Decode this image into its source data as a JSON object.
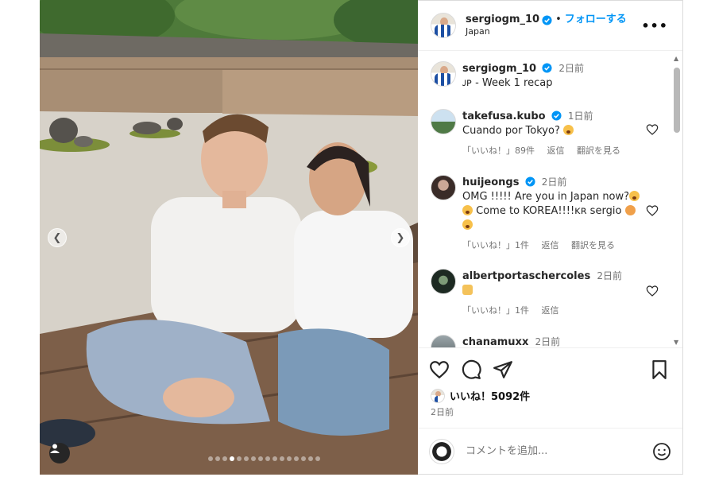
{
  "post": {
    "username": "sergiogm_10",
    "follow_label": "フォローする",
    "separator": "•",
    "location": "Japan",
    "more_label": "•••"
  },
  "caption": {
    "username": "sergiogm_10",
    "time": "2日前",
    "text": "ᴊᴘ - Week 1 recap"
  },
  "comments": [
    {
      "username": "takefusa.kubo",
      "time": "1日前",
      "text": "Cuando por Tokyo?",
      "likes": "「いいね！」89件",
      "reply": "返信",
      "translate": "翻訳を見る"
    },
    {
      "username": "huijeongs",
      "time": "2日前",
      "text_line1": "OMG !!!!! Are you in Japan now?",
      "text_line2": "Come to KOREA!!!!ᴋʀ sergio",
      "likes": "「いいね！」1件",
      "reply": "返信",
      "translate": "翻訳を見る"
    },
    {
      "username": "albertportaschercoles",
      "time": "2日前",
      "likes": "「いいね！」1件",
      "reply": "返信"
    },
    {
      "username": "chanamuxx",
      "time": "2日前"
    }
  ],
  "likes_summary": "いいね！5092件",
  "post_time": "2日前",
  "comment_input": {
    "placeholder": "コメントを追加..."
  },
  "carousel": {
    "slide_count": 16,
    "active_index": 3
  },
  "colors": {
    "accent": "#0095f6",
    "verified": "#0095f6",
    "muted": "#737373"
  }
}
